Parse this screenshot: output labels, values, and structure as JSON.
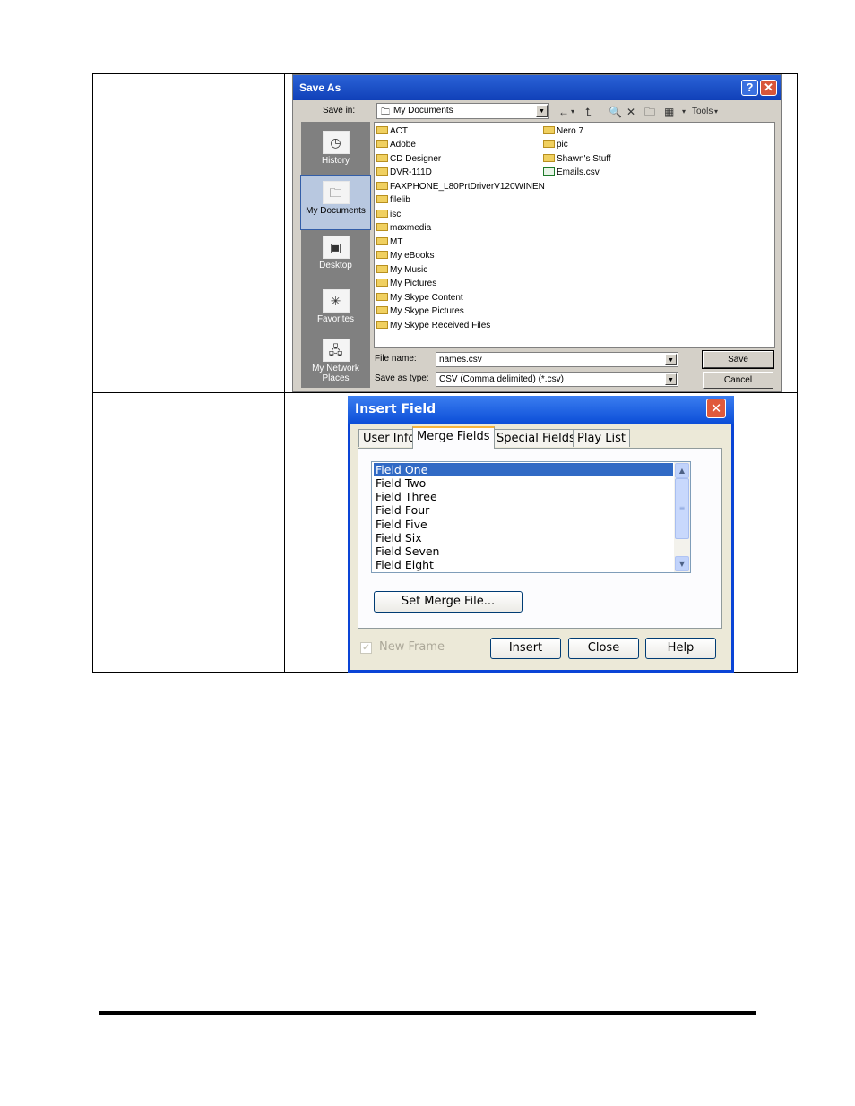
{
  "save_as": {
    "title": "Save As",
    "help_button": "?",
    "close_button": "✕",
    "save_in_label": "Save in:",
    "save_in_value": "My Documents",
    "tools_label": "Tools",
    "places": [
      "History",
      "My Documents",
      "Desktop",
      "Favorites",
      "My Network Places"
    ],
    "files_col1": [
      "ACT",
      "Adobe",
      "CD Designer",
      "DVR-111D",
      "FAXPHONE_L80PrtDriverV120WINEN",
      "filelib",
      "isc",
      "maxmedia",
      "MT",
      "My eBooks",
      "My Music",
      "My Pictures",
      "My Skype Content",
      "My Skype Pictures",
      "My Skype Received Files"
    ],
    "files_col2": [
      "Nero 7",
      "pic",
      "Shawn's Stuff",
      "Emails.csv"
    ],
    "file_name_label": "File name:",
    "file_name_value": "names.csv",
    "save_as_type_label": "Save as type:",
    "save_as_type_value": "CSV (Comma delimited) (*.csv)",
    "save_button": "Save",
    "cancel_button": "Cancel"
  },
  "insert_field": {
    "title": "Insert Field",
    "close_button": "✕",
    "tabs": [
      "User Info",
      "Merge Fields",
      "Special Fields",
      "Play List"
    ],
    "fields": [
      "Field One",
      "Field Two",
      "Field Three",
      "Field Four",
      "Field Five",
      "Field Six",
      "Field Seven",
      "Field Eight"
    ],
    "set_merge_file_button": "Set Merge File...",
    "new_frame_label": "New Frame",
    "insert_button": "Insert",
    "close_label": "Close",
    "help_button": "Help"
  }
}
